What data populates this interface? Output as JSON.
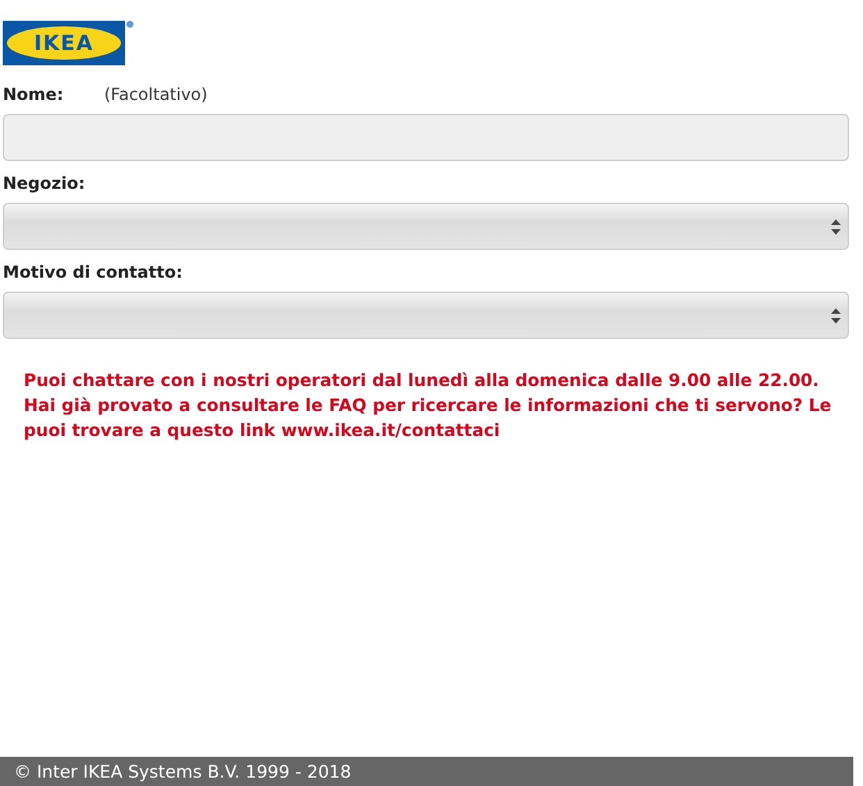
{
  "logo": {
    "text": "IKEA"
  },
  "fields": [
    {
      "label": "Nome:",
      "hint": "(Facoltativo)",
      "kind": "text"
    },
    {
      "label": "Negozio:",
      "kind": "select"
    },
    {
      "label": "Motivo di contatto:",
      "kind": "select"
    }
  ],
  "notice": "Puoi chattare con i nostri operatori dal lunedì alla domenica dalle 9.00 alle 22.00. Hai già provato a consultare le FAQ per ricercare le informazioni che ti servono? Le puoi trovare a questo link www.ikea.it/contattaci",
  "footer": "© Inter IKEA Systems B.V. 1999 - 2018"
}
